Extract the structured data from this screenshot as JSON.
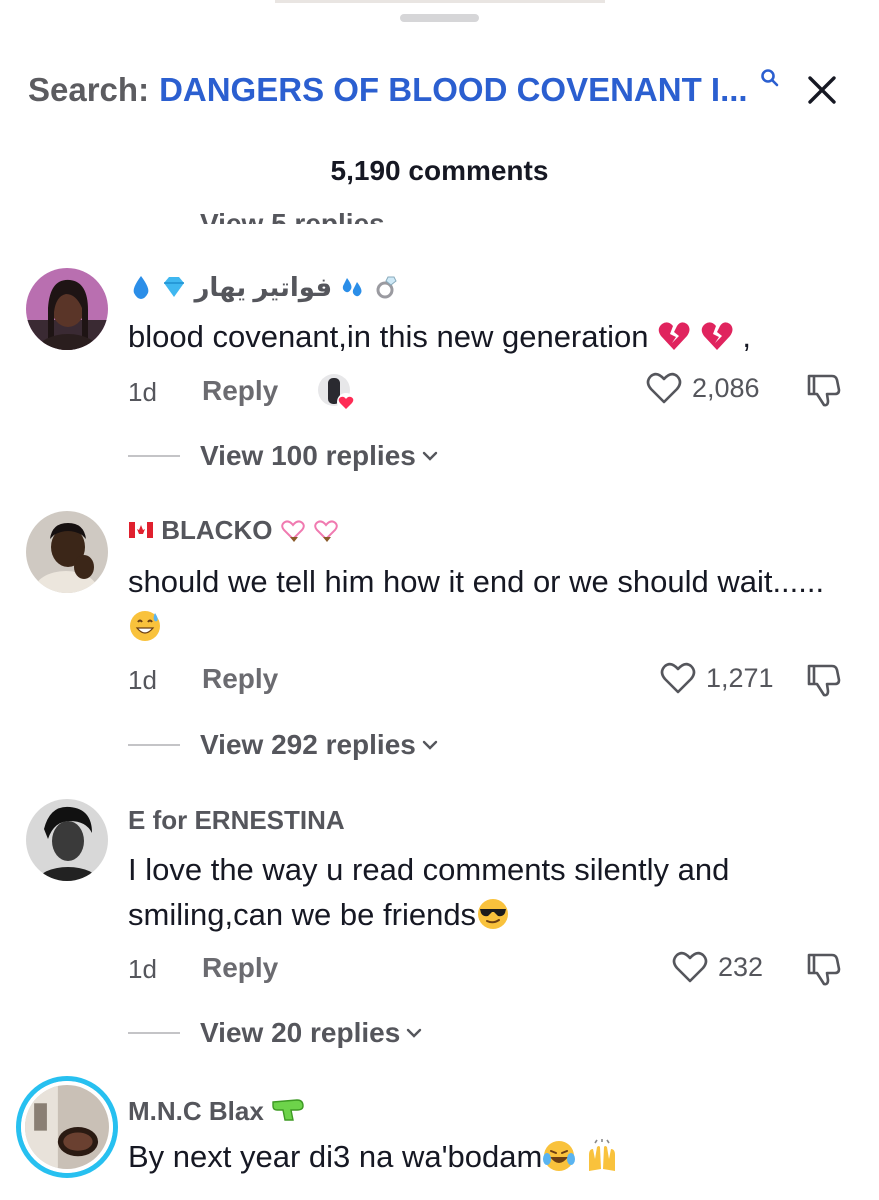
{
  "header": {
    "search_prefix": "Search:",
    "search_query": "DANGERS OF BLOOD COVENANT I...",
    "comment_count": "5,190 comments",
    "clipped_line": "View 5 replies"
  },
  "labels": {
    "reply": "Reply"
  },
  "comments": [
    {
      "username": "فواتير يهار",
      "text": "blood covenant,in this new generation",
      "text_suffix": ",",
      "time": "1d",
      "likes": "2,086",
      "replies": "View 100 replies"
    },
    {
      "username": "BLACKO",
      "text": "should we tell him how it end or we should wait......",
      "time": "1d",
      "likes": "1,271",
      "replies": "View 292 replies"
    },
    {
      "username": "E for ERNESTINA",
      "text": "I love the way u read comments silently and smiling,can we be friends",
      "time": "1d",
      "likes": "232",
      "replies": "View 20 replies"
    },
    {
      "username": "M.N.C Blax",
      "text": "By next year di3 na wa'bodam"
    }
  ],
  "colors": {
    "link_blue": "#2b5fd0",
    "muted": "#55565c",
    "story_ring": "#27c0f0",
    "heart_red": "#fe2c55"
  }
}
